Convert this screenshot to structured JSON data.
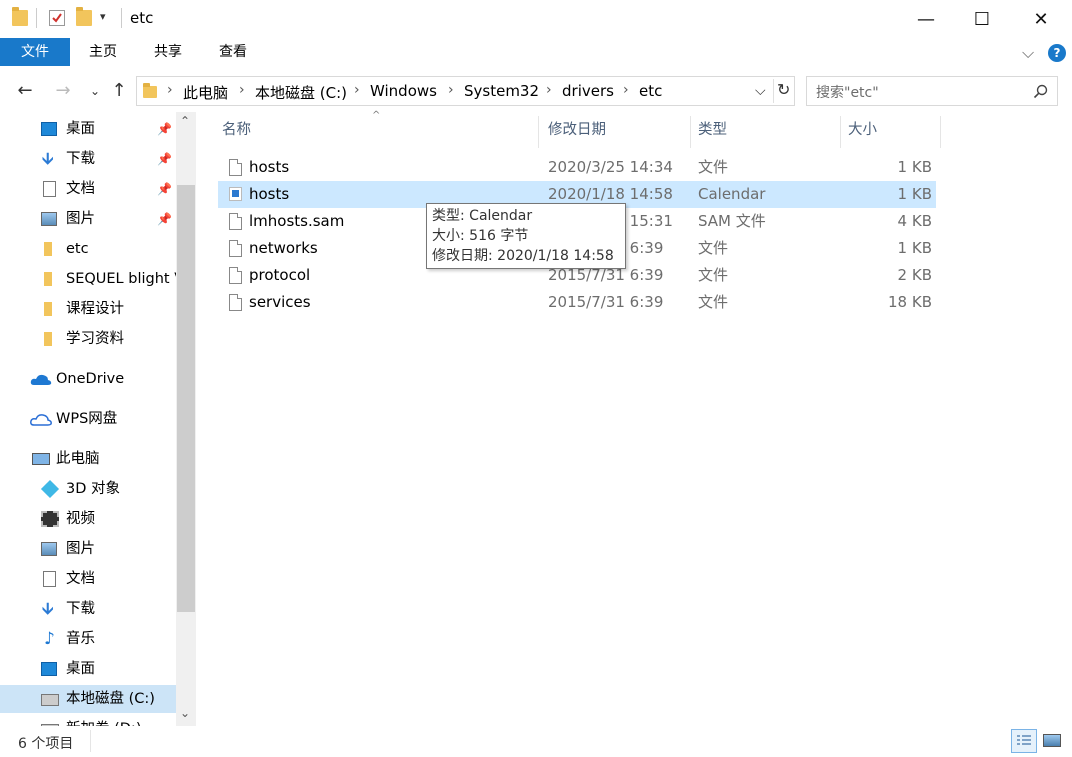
{
  "window": {
    "title": "etc",
    "minimize_glyph": "—",
    "maximize_glyph": "☐",
    "close_glyph": "✕"
  },
  "ribbon": {
    "tabs": [
      {
        "label": "文件",
        "active": true
      },
      {
        "label": "主页",
        "active": false
      },
      {
        "label": "共享",
        "active": false
      },
      {
        "label": "查看",
        "active": false
      }
    ]
  },
  "address": {
    "crumbs": [
      "此电脑",
      "本地磁盘 (C:)",
      "Windows",
      "System32",
      "drivers",
      "etc"
    ],
    "separator": "›"
  },
  "search": {
    "placeholder": "搜索\"etc\""
  },
  "sidebar": {
    "quick_access": [
      {
        "label": "桌面",
        "icon": "desktop-icon",
        "pinned": true
      },
      {
        "label": "下载",
        "icon": "download-icon",
        "pinned": true
      },
      {
        "label": "文档",
        "icon": "document-icon",
        "pinned": true
      },
      {
        "label": "图片",
        "icon": "picture-icon",
        "pinned": true
      },
      {
        "label": "etc",
        "icon": "folder-icon",
        "pinned": false
      },
      {
        "label": "SEQUEL blight V",
        "icon": "folder-icon",
        "pinned": false
      },
      {
        "label": "课程设计",
        "icon": "folder-icon",
        "pinned": false
      },
      {
        "label": "学习资料",
        "icon": "folder-icon",
        "pinned": false
      }
    ],
    "onedrive": "OneDrive",
    "wps": "WPS网盘",
    "this_pc": "此电脑",
    "this_pc_items": [
      {
        "label": "3D 对象",
        "icon": "3d-objects-icon"
      },
      {
        "label": "视频",
        "icon": "video-icon"
      },
      {
        "label": "图片",
        "icon": "picture-icon"
      },
      {
        "label": "文档",
        "icon": "document-icon"
      },
      {
        "label": "下载",
        "icon": "download-icon"
      },
      {
        "label": "音乐",
        "icon": "music-icon"
      },
      {
        "label": "桌面",
        "icon": "desktop-icon"
      },
      {
        "label": "本地磁盘 (C:)",
        "icon": "drive-icon",
        "selected": true
      },
      {
        "label": "新加卷 (D:)",
        "icon": "drive-icon"
      }
    ]
  },
  "columns": {
    "name": "名称",
    "date": "修改日期",
    "type": "类型",
    "size": "大小"
  },
  "files": [
    {
      "name": "hosts",
      "date": "2020/3/25 14:34",
      "type": "文件",
      "size": "1 KB",
      "icon": "file-icon"
    },
    {
      "name": "hosts",
      "date": "2020/1/18 14:58",
      "type": "Calendar",
      "size": "1 KB",
      "icon": "calendar-file-icon",
      "selected": true
    },
    {
      "name": "lmhosts.sam",
      "date": "2015/7/31 15:31",
      "type": "SAM 文件",
      "size": "4 KB",
      "icon": "file-icon"
    },
    {
      "name": "networks",
      "date": "2015/7/31 6:39",
      "type": "文件",
      "size": "1 KB",
      "icon": "file-icon"
    },
    {
      "name": "protocol",
      "date": "2015/7/31 6:39",
      "type": "文件",
      "size": "2 KB",
      "icon": "file-icon"
    },
    {
      "name": "services",
      "date": "2015/7/31 6:39",
      "type": "文件",
      "size": "18 KB",
      "icon": "file-icon"
    }
  ],
  "tooltip": {
    "type_line": "类型: Calendar",
    "size_line": "大小: 516 字节",
    "date_line": "修改日期: 2020/1/18 14:58"
  },
  "status": {
    "item_count": "6 个项目"
  },
  "colors": {
    "accent": "#1979ca",
    "selection": "#cce8ff",
    "nav_selection": "#cce4f7"
  }
}
